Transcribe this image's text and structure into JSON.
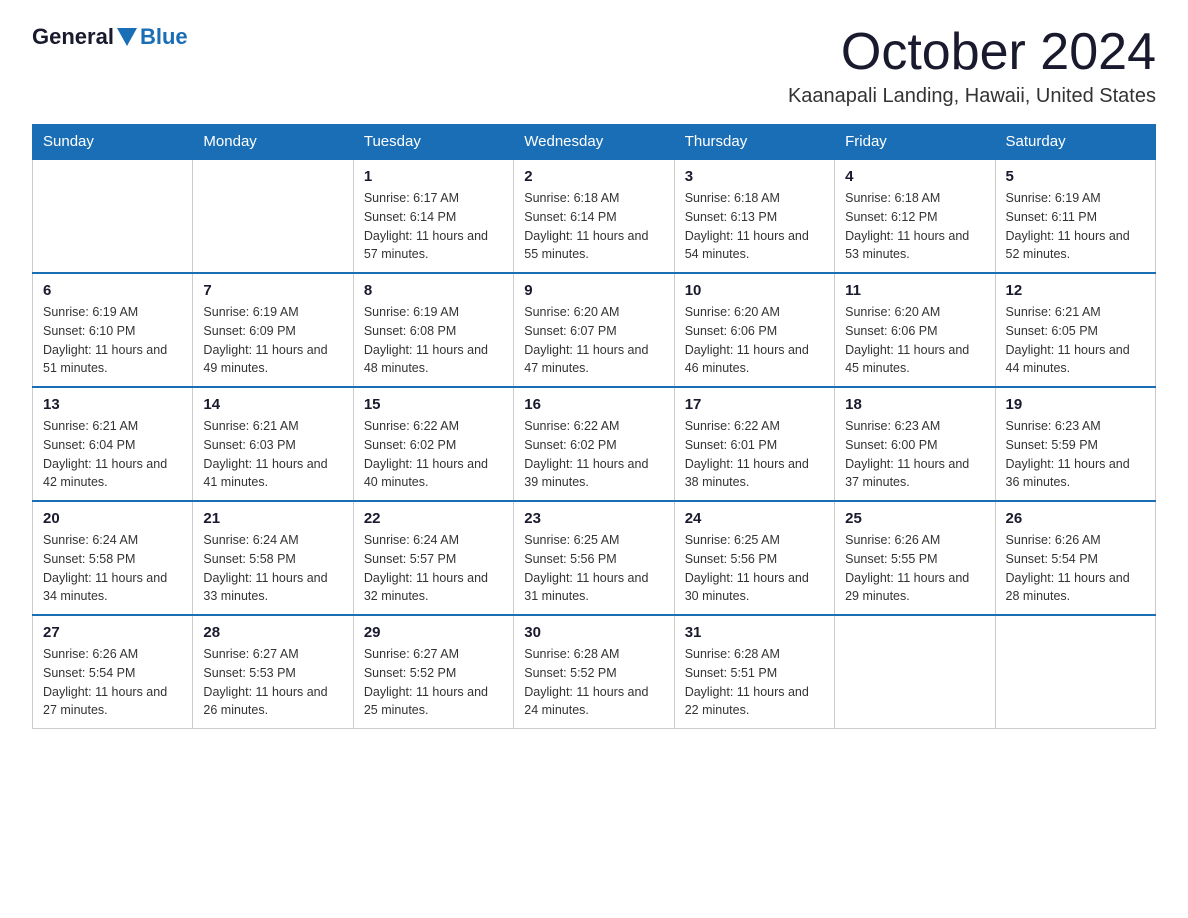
{
  "header": {
    "logo_general": "General",
    "logo_blue": "Blue",
    "month_title": "October 2024",
    "location": "Kaanapali Landing, Hawaii, United States"
  },
  "days_of_week": [
    "Sunday",
    "Monday",
    "Tuesday",
    "Wednesday",
    "Thursday",
    "Friday",
    "Saturday"
  ],
  "weeks": [
    [
      {
        "day": "",
        "info": ""
      },
      {
        "day": "",
        "info": ""
      },
      {
        "day": "1",
        "info": "Sunrise: 6:17 AM\nSunset: 6:14 PM\nDaylight: 11 hours\nand 57 minutes."
      },
      {
        "day": "2",
        "info": "Sunrise: 6:18 AM\nSunset: 6:14 PM\nDaylight: 11 hours\nand 55 minutes."
      },
      {
        "day": "3",
        "info": "Sunrise: 6:18 AM\nSunset: 6:13 PM\nDaylight: 11 hours\nand 54 minutes."
      },
      {
        "day": "4",
        "info": "Sunrise: 6:18 AM\nSunset: 6:12 PM\nDaylight: 11 hours\nand 53 minutes."
      },
      {
        "day": "5",
        "info": "Sunrise: 6:19 AM\nSunset: 6:11 PM\nDaylight: 11 hours\nand 52 minutes."
      }
    ],
    [
      {
        "day": "6",
        "info": "Sunrise: 6:19 AM\nSunset: 6:10 PM\nDaylight: 11 hours\nand 51 minutes."
      },
      {
        "day": "7",
        "info": "Sunrise: 6:19 AM\nSunset: 6:09 PM\nDaylight: 11 hours\nand 49 minutes."
      },
      {
        "day": "8",
        "info": "Sunrise: 6:19 AM\nSunset: 6:08 PM\nDaylight: 11 hours\nand 48 minutes."
      },
      {
        "day": "9",
        "info": "Sunrise: 6:20 AM\nSunset: 6:07 PM\nDaylight: 11 hours\nand 47 minutes."
      },
      {
        "day": "10",
        "info": "Sunrise: 6:20 AM\nSunset: 6:06 PM\nDaylight: 11 hours\nand 46 minutes."
      },
      {
        "day": "11",
        "info": "Sunrise: 6:20 AM\nSunset: 6:06 PM\nDaylight: 11 hours\nand 45 minutes."
      },
      {
        "day": "12",
        "info": "Sunrise: 6:21 AM\nSunset: 6:05 PM\nDaylight: 11 hours\nand 44 minutes."
      }
    ],
    [
      {
        "day": "13",
        "info": "Sunrise: 6:21 AM\nSunset: 6:04 PM\nDaylight: 11 hours\nand 42 minutes."
      },
      {
        "day": "14",
        "info": "Sunrise: 6:21 AM\nSunset: 6:03 PM\nDaylight: 11 hours\nand 41 minutes."
      },
      {
        "day": "15",
        "info": "Sunrise: 6:22 AM\nSunset: 6:02 PM\nDaylight: 11 hours\nand 40 minutes."
      },
      {
        "day": "16",
        "info": "Sunrise: 6:22 AM\nSunset: 6:02 PM\nDaylight: 11 hours\nand 39 minutes."
      },
      {
        "day": "17",
        "info": "Sunrise: 6:22 AM\nSunset: 6:01 PM\nDaylight: 11 hours\nand 38 minutes."
      },
      {
        "day": "18",
        "info": "Sunrise: 6:23 AM\nSunset: 6:00 PM\nDaylight: 11 hours\nand 37 minutes."
      },
      {
        "day": "19",
        "info": "Sunrise: 6:23 AM\nSunset: 5:59 PM\nDaylight: 11 hours\nand 36 minutes."
      }
    ],
    [
      {
        "day": "20",
        "info": "Sunrise: 6:24 AM\nSunset: 5:58 PM\nDaylight: 11 hours\nand 34 minutes."
      },
      {
        "day": "21",
        "info": "Sunrise: 6:24 AM\nSunset: 5:58 PM\nDaylight: 11 hours\nand 33 minutes."
      },
      {
        "day": "22",
        "info": "Sunrise: 6:24 AM\nSunset: 5:57 PM\nDaylight: 11 hours\nand 32 minutes."
      },
      {
        "day": "23",
        "info": "Sunrise: 6:25 AM\nSunset: 5:56 PM\nDaylight: 11 hours\nand 31 minutes."
      },
      {
        "day": "24",
        "info": "Sunrise: 6:25 AM\nSunset: 5:56 PM\nDaylight: 11 hours\nand 30 minutes."
      },
      {
        "day": "25",
        "info": "Sunrise: 6:26 AM\nSunset: 5:55 PM\nDaylight: 11 hours\nand 29 minutes."
      },
      {
        "day": "26",
        "info": "Sunrise: 6:26 AM\nSunset: 5:54 PM\nDaylight: 11 hours\nand 28 minutes."
      }
    ],
    [
      {
        "day": "27",
        "info": "Sunrise: 6:26 AM\nSunset: 5:54 PM\nDaylight: 11 hours\nand 27 minutes."
      },
      {
        "day": "28",
        "info": "Sunrise: 6:27 AM\nSunset: 5:53 PM\nDaylight: 11 hours\nand 26 minutes."
      },
      {
        "day": "29",
        "info": "Sunrise: 6:27 AM\nSunset: 5:52 PM\nDaylight: 11 hours\nand 25 minutes."
      },
      {
        "day": "30",
        "info": "Sunrise: 6:28 AM\nSunset: 5:52 PM\nDaylight: 11 hours\nand 24 minutes."
      },
      {
        "day": "31",
        "info": "Sunrise: 6:28 AM\nSunset: 5:51 PM\nDaylight: 11 hours\nand 22 minutes."
      },
      {
        "day": "",
        "info": ""
      },
      {
        "day": "",
        "info": ""
      }
    ]
  ]
}
